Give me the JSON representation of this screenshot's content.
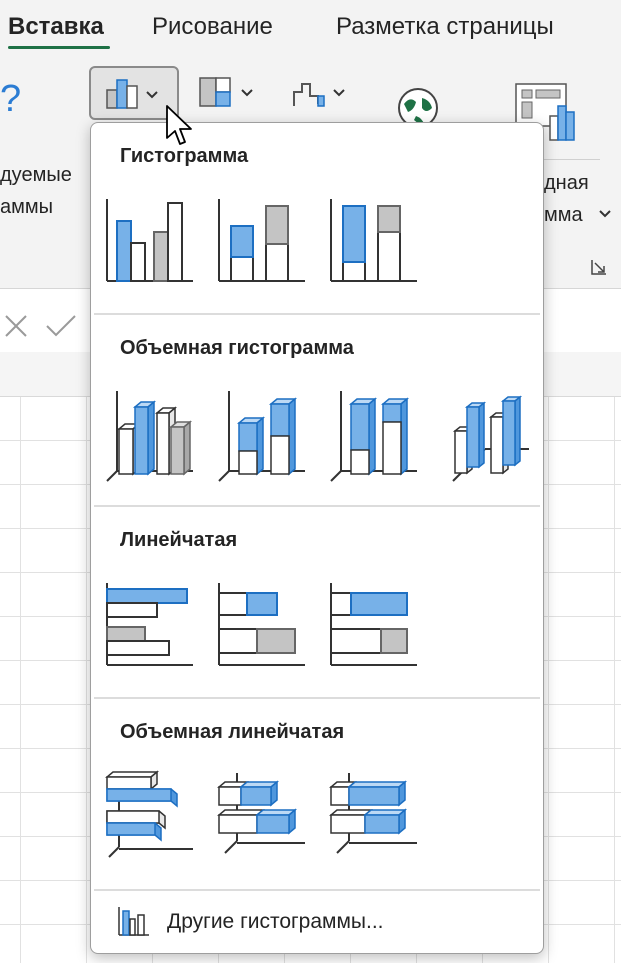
{
  "ribbon_tabs": [
    {
      "label": "Вставка",
      "active": true
    },
    {
      "label": "Рисование",
      "active": false
    },
    {
      "label": "Разметка страницы",
      "active": false
    }
  ],
  "ribbon": {
    "recommended_label_line1": "дуемые",
    "recommended_label_line2": "аммы",
    "pivot_label_line1": "дная",
    "pivot_label_line2": "мма",
    "help_glyph": "?"
  },
  "dropdown": {
    "sections": [
      {
        "title": "Гистограмма"
      },
      {
        "title": "Объемная гистограмма"
      },
      {
        "title": "Линейчатая"
      },
      {
        "title": "Объемная линейчатая"
      }
    ],
    "more_charts_label": "Другие гистограммы..."
  },
  "colors": {
    "accent_blue": "#77b1e8",
    "blue_stroke": "#1d6fc2",
    "gray_fill": "#c4c4c4",
    "excel_green": "#1e7145"
  }
}
